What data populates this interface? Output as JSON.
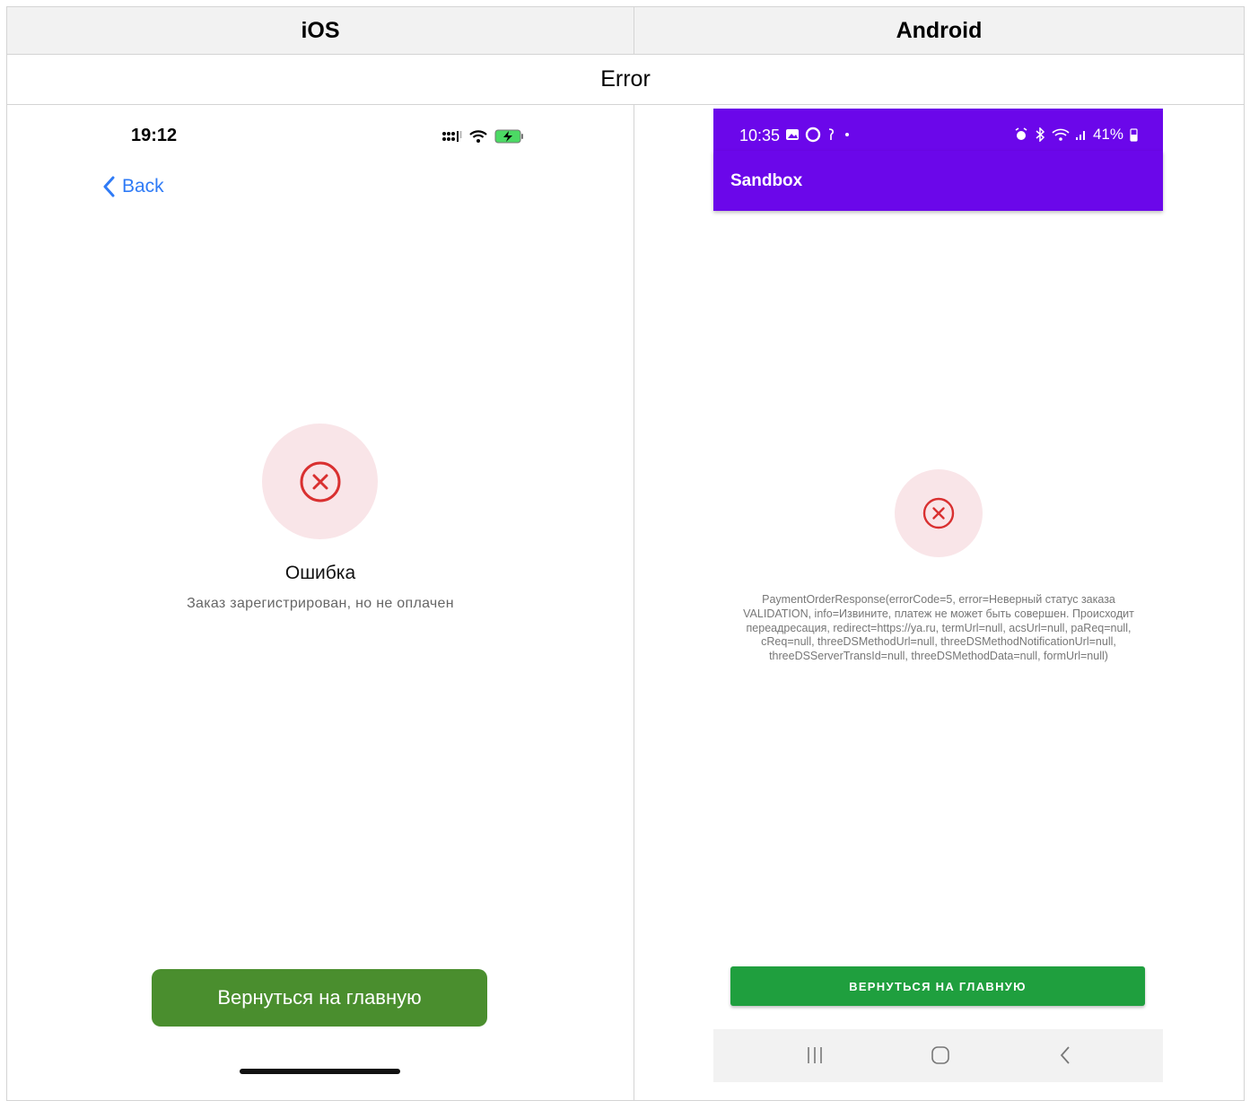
{
  "table": {
    "col_ios": "iOS",
    "col_android": "Android",
    "row_label": "Error"
  },
  "ios": {
    "time": "19:12",
    "back_label": "Back",
    "error_title": "Ошибка",
    "error_subtitle": "Заказ зарегистрирован, но не оплачен",
    "button_label": "Вернуться на главную",
    "colors": {
      "accent": "#2f7bf6",
      "button": "#4a8e2e",
      "error": "#d93030",
      "error_bg": "#f9e5e8"
    },
    "icons": [
      "signal-icon",
      "wifi-icon",
      "battery-charging-icon",
      "chevron-left-icon",
      "error-x-circle-icon"
    ]
  },
  "android": {
    "time": "10:35",
    "battery": "41%",
    "app_title": "Sandbox",
    "error_message": "PaymentOrderResponse(errorCode=5, error=Неверный статус заказа VALIDATION, info=Извините, платеж не может быть совершен. Происходит переадресация, redirect=https://ya.ru, termUrl=null, acsUrl=null, paReq=null, cReq=null, threeDSMethodUrl=null, threeDSMethodNotificationUrl=null, threeDSServerTransId=null, threeDSMethodData=null, formUrl=null)",
    "button_label": "ВЕРНУТЬСЯ НА ГЛАВНУЮ",
    "colors": {
      "bar": "#6b07ea",
      "button": "#1f9f3e",
      "error": "#d93030",
      "error_bg": "#f9e5e8",
      "nav_bg": "#f2f2f2"
    },
    "icons": [
      "gallery-icon",
      "circle-icon",
      "music-note-icon",
      "dot-icon",
      "alarm-icon",
      "bluetooth-icon",
      "wifi-icon",
      "signal-icon",
      "battery-icon",
      "error-x-circle-icon",
      "recents-icon",
      "home-icon",
      "back-icon"
    ]
  }
}
